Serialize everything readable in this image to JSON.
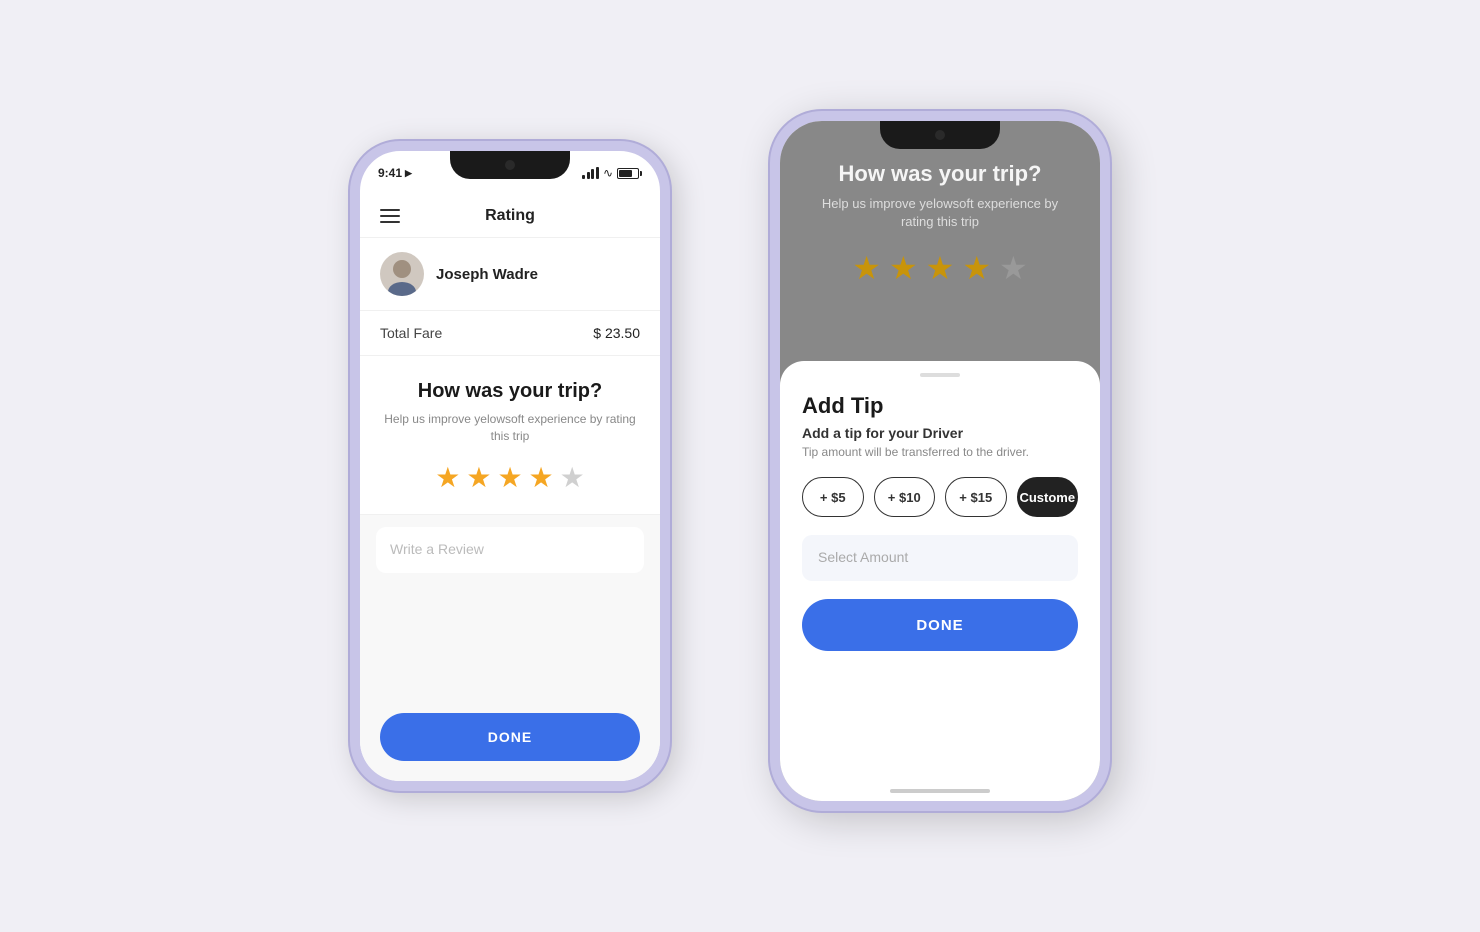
{
  "phone1": {
    "status": {
      "time": "9:41",
      "arrow": "▶"
    },
    "header": {
      "menu_label": "menu",
      "title": "Rating"
    },
    "driver": {
      "name": "Joseph Wadre"
    },
    "fare": {
      "label": "Total Fare",
      "value": "$ 23.50"
    },
    "rating": {
      "title": "How was your trip?",
      "subtitle": "Help us improve yelowsoft experience by rating this trip",
      "stars": [
        {
          "filled": true
        },
        {
          "filled": true
        },
        {
          "filled": true
        },
        {
          "filled": true
        },
        {
          "filled": false
        }
      ]
    },
    "review": {
      "placeholder": "Write a Review"
    },
    "done_button": "DONE"
  },
  "phone2": {
    "bg": {
      "title": "How was your trip?",
      "subtitle": "Help us improve yelowsoft experience by rating this trip",
      "stars": [
        {
          "filled": true
        },
        {
          "filled": true
        },
        {
          "filled": true
        },
        {
          "filled": true
        },
        {
          "filled": false
        }
      ]
    },
    "sheet": {
      "handle": true,
      "title": "Add Tip",
      "subtitle": "Add a tip for your Driver",
      "description": "Tip amount will be transferred to the driver.",
      "tip_buttons": [
        {
          "label": "+ $5",
          "active": false
        },
        {
          "label": "+ $10",
          "active": false
        },
        {
          "label": "+ $15",
          "active": false
        },
        {
          "label": "Custome",
          "active": true
        }
      ],
      "amount_placeholder": "Select Amount",
      "done_button": "DONE"
    }
  }
}
